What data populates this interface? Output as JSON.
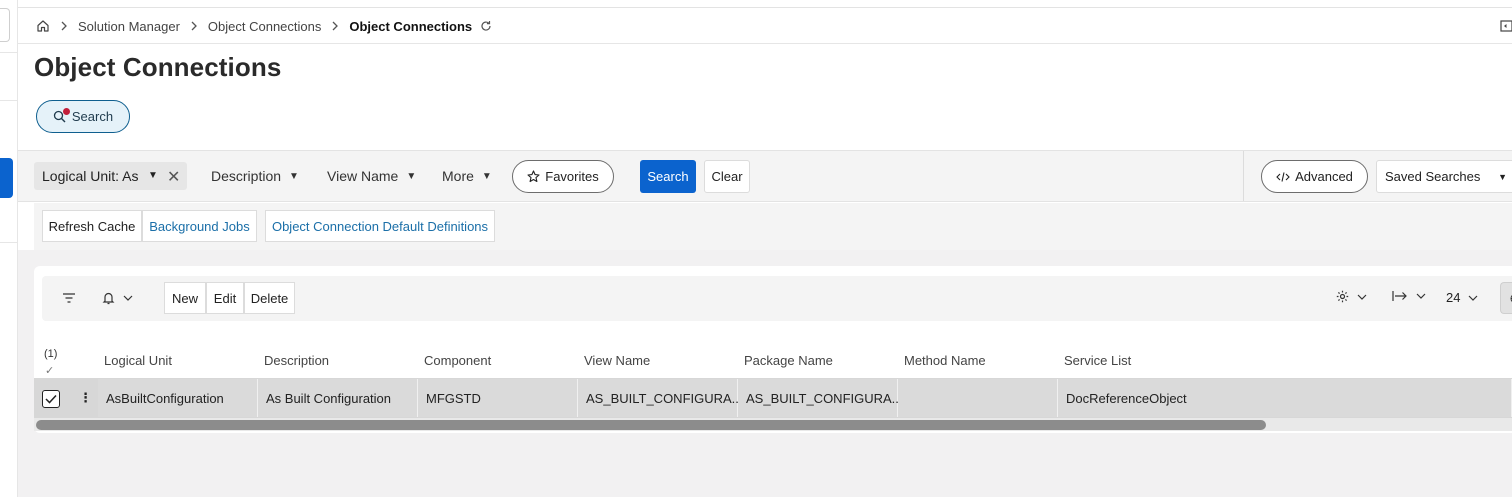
{
  "breadcrumb": {
    "items": [
      "Solution Manager",
      "Object Connections"
    ],
    "current": "Object Connections"
  },
  "page": {
    "title": "Object Connections"
  },
  "search_toggle": {
    "label": "Search"
  },
  "filters": {
    "chip": "Logical Unit: As",
    "dropdowns": [
      "Description",
      "View Name",
      "More"
    ],
    "favorites_label": "Favorites",
    "search_label": "Search",
    "clear_label": "Clear",
    "advanced_label": "Advanced",
    "saved_searches_label": "Saved Searches"
  },
  "actions": {
    "refresh_cache": "Refresh Cache",
    "background_jobs": "Background Jobs",
    "default_definitions": "Object Connection Default Definitions"
  },
  "table": {
    "toolbar": {
      "new": "New",
      "edit": "Edit",
      "delete": "Delete",
      "page_size": "24"
    },
    "selected_count": "(1)",
    "columns": [
      "Logical Unit",
      "Description",
      "Component",
      "View Name",
      "Package Name",
      "Method Name",
      "Service List"
    ],
    "rows": [
      {
        "selected": true,
        "cells": [
          "AsBuiltConfiguration",
          "As Built Configuration",
          "MFGSTD",
          "AS_BUILT_CONFIGURA...",
          "AS_BUILT_CONFIGURA...",
          "",
          "DocReferenceObject"
        ]
      }
    ]
  },
  "colors": {
    "primary": "#0b63ce",
    "link": "#1b6fa8",
    "notification_dot": "#c21f3a",
    "selected_row": "#d7d7d7"
  }
}
